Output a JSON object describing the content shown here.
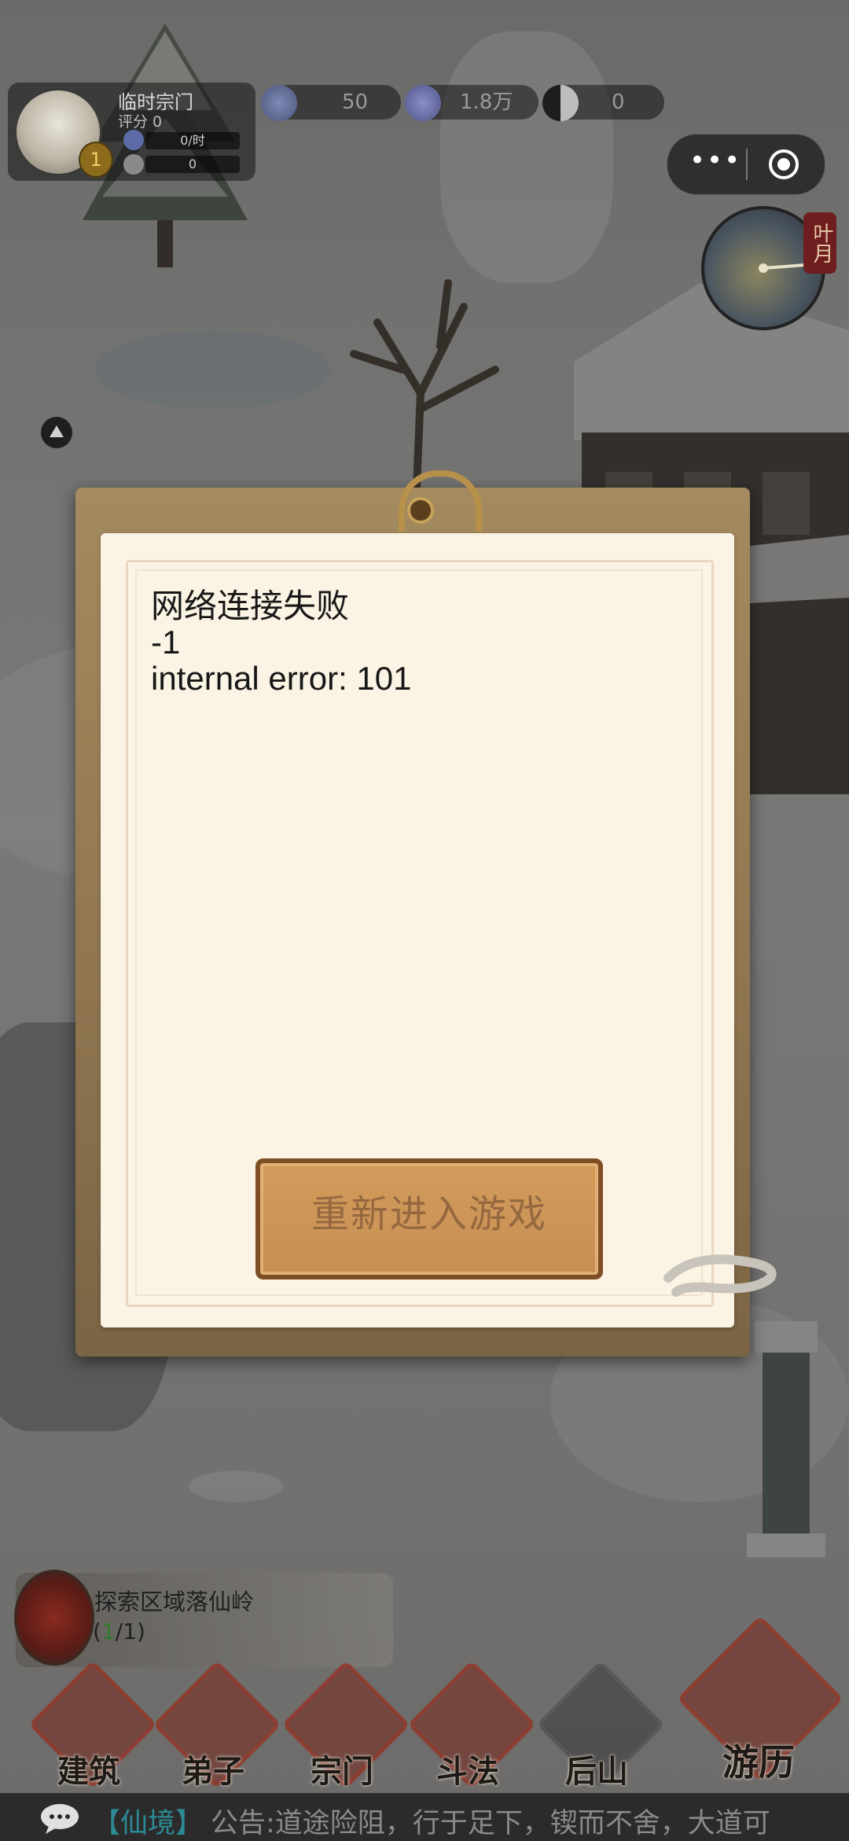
{
  "hud": {
    "sect_name": "临时宗门",
    "rating": "评分 0",
    "level": "1",
    "rate_per_hour": "0/时",
    "rate_value": "0",
    "resources": [
      {
        "icon": "spirit-fruit-icon",
        "value": "50"
      },
      {
        "icon": "spirit-stone-icon",
        "value": "1.8万"
      },
      {
        "icon": "yin-yang-icon",
        "value": "0"
      }
    ]
  },
  "clock": {
    "month_label": "叶月"
  },
  "dialog": {
    "title": "网络连接失败",
    "code": "-1",
    "detail": "internal error: 101",
    "button_label": "重新进入游戏"
  },
  "quest": {
    "title": "探索区域落仙岭",
    "progress_open": "(",
    "progress_done": "1",
    "progress_rest": "/1)"
  },
  "nav": [
    {
      "label": "建筑"
    },
    {
      "label": "弟子"
    },
    {
      "label": "宗门"
    },
    {
      "label": "斗法"
    },
    {
      "label": "后山"
    },
    {
      "label": "游历"
    }
  ],
  "announcement": {
    "tag": "【仙境】",
    "text": "公告:道途险阻，行于足下，锲而不舍，大道可"
  }
}
